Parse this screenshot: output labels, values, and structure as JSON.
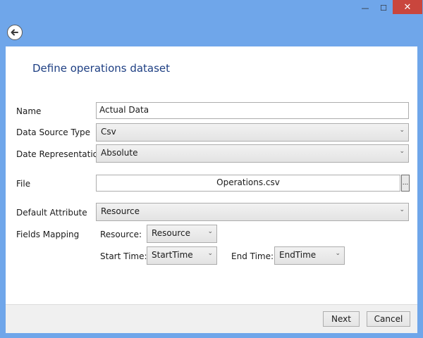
{
  "window": {
    "minimize": "—",
    "maximize": "☐",
    "close": "✕"
  },
  "icons": {
    "back": "back-arrow-icon",
    "dropdown": "chevron-down-icon"
  },
  "page": {
    "title": "Define operations dataset"
  },
  "form": {
    "name_label": "Name",
    "name_value": "Actual Data",
    "data_source_type_label": "Data Source Type",
    "data_source_type_value": "Csv",
    "date_representation_label": "Date Representation",
    "date_representation_value": "Absolute",
    "file_label": "File",
    "file_value": "Operations.csv",
    "browse_label": "...",
    "default_attribute_label": "Default Attribute",
    "default_attribute_value": "Resource",
    "fields_mapping_label": "Fields Mapping",
    "resource_label": "Resource:",
    "resource_value": "Resource",
    "start_time_label": "Start Time:",
    "start_time_value": "StartTime",
    "end_time_label": "End Time:",
    "end_time_value": "EndTime"
  },
  "buttons": {
    "next": "Next",
    "cancel": "Cancel"
  },
  "colors": {
    "window_frame": "#6fa6ea",
    "title_text": "#1e3f83",
    "close_button": "#c9463d"
  }
}
